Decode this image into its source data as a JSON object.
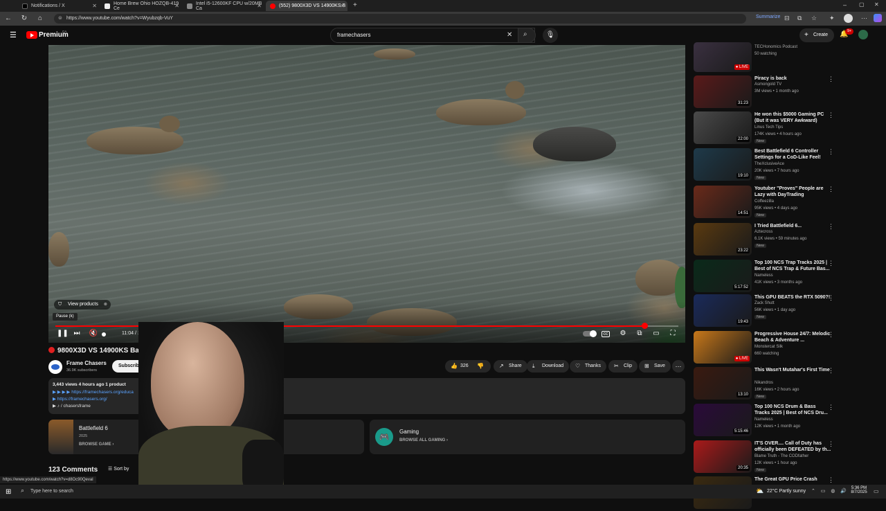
{
  "browser": {
    "tabs": [
      {
        "title": "Notifications / X",
        "active": false
      },
      {
        "title": "Home Brew Ohio HOZQB-419 Ce",
        "active": false
      },
      {
        "title": "Intel i5-12600KF CPU w/20MB Ca",
        "active": false
      },
      {
        "title": "(552) 9800X3D VS 14900KS B",
        "active": true
      }
    ],
    "url": "https://www.youtube.com/watch?v=Wyubzqb-VuY",
    "summarize_label": "Summarize",
    "status_url": "https://www.youtube.com/watch?v=d8Oc90Qeval"
  },
  "youtube": {
    "logo_text": "Premium",
    "logo_region": "CA",
    "search_value": "framechasers",
    "create_label": "Create",
    "notif_count": "9+"
  },
  "player": {
    "view_products": "View products",
    "tooltip": "Pause (k)",
    "time": "11:04 / 11:39",
    "progress": 0.945
  },
  "video": {
    "title": "9800X3D VS 14900KS Battlefield 6",
    "title_suffix": "KS",
    "channel": "Frame Chasers",
    "subscribers": "36.9K subscribers",
    "subscribe_label": "Subscribe",
    "likes": "326",
    "share": "Share",
    "download": "Download",
    "thanks": "Thanks",
    "clip": "Clip",
    "save": "Save",
    "desc_meta": "3,443 views  4 hours ago  1 product",
    "desc_links": [
      "▶ ▶ ▶ ▶  https://framechasers.org/educa",
      "▶  https://framechasers.org/",
      "▶  ♪ / chasersframe"
    ],
    "desc_tail": "SE",
    "game_title": "Battlefield 6",
    "game_year": "2025",
    "browse_game": "BROWSE GAME",
    "gaming_title": "Gaming",
    "browse_gaming": "BROWSE ALL GAMING",
    "comments": "123 Comments",
    "sort": "Sort by"
  },
  "recommendations": [
    {
      "title": "",
      "channel": "TECHonomics Podcast",
      "meta": "50 watching",
      "dur": "LIVE",
      "new": false,
      "color": "#3a3040"
    },
    {
      "title": "Piracy is back",
      "channel": "Asmongold TV",
      "meta": "3M views • 1 month ago",
      "dur": "31:23",
      "new": false,
      "color": "#5a1a1a"
    },
    {
      "title": "He won this $5000 Gaming PC (But it was VERY Awkward)",
      "channel": "Linus Tech Tips",
      "meta": "174K views • 4 hours ago",
      "dur": "22:00",
      "new": true,
      "color": "#4a4a4a"
    },
    {
      "title": "Best Battlefield 6 Controller Settings for a CoD-Like Feel!",
      "channel": "TheXclusiveAce",
      "meta": "20K views • 7 hours ago",
      "dur": "19:10",
      "new": true,
      "color": "#1e3a4a"
    },
    {
      "title": "Youtuber \"Proves\" People are Lazy with DayTrading",
      "channel": "Coffeezilla",
      "meta": "95K views • 4 days ago",
      "dur": "14:51",
      "new": true,
      "color": "#6a2a1a"
    },
    {
      "title": "I Tried Battlefield 6...",
      "channel": "Aztecross",
      "meta": "6.1K views • 59 minutes ago",
      "dur": "23:22",
      "new": true,
      "color": "#5a3a10"
    },
    {
      "title": "Top 100 NCS Trap Tracks 2025 | Best of NCS Trap & Future Bas...",
      "channel": "Nameless",
      "meta": "41K views • 3 months ago",
      "dur": "5:17:52",
      "new": false,
      "color": "#0a2a1a"
    },
    {
      "title": "This GPU BEATS the RTX 5090?!",
      "channel": "Zack Shutt",
      "meta": "56K views • 1 day ago",
      "dur": "19:43",
      "new": true,
      "color": "#1a2a5a"
    },
    {
      "title": "Progressive House 24/7: Melodic Beach & Adventure ...",
      "channel": "Monstercat Silk",
      "meta": "660 watching",
      "dur": "LIVE",
      "new": false,
      "color": "#c8781a"
    },
    {
      "title": "This Wasn't Mutahar's First Time",
      "channel": "Nikandros",
      "meta": "16K views • 2 hours ago",
      "dur": "13:10",
      "new": true,
      "color": "#3a1a10"
    },
    {
      "title": "Top 100 NCS Drum & Bass Tracks 2025 | Best of NCS Dru...",
      "channel": "Nameless",
      "meta": "12K views • 1 month ago",
      "dur": "5:15:46",
      "new": false,
      "color": "#2a0a3a"
    },
    {
      "title": "IT'S OVER.... Call of Duty has officially been DEFEATED by th...",
      "channel": "Blame Truth - The CODfather",
      "meta": "12K views • 1 hour ago",
      "dur": "20:35",
      "new": true,
      "color": "#aa1a1a"
    },
    {
      "title": "The Great GPU Price Crash",
      "channel": "",
      "meta": "",
      "dur": "",
      "new": false,
      "color": "#3a2a10"
    }
  ],
  "taskbar": {
    "search_placeholder": "Type here to search",
    "weather": "22°C  Partly sunny",
    "time": "5:36 PM",
    "date": "8/7/2025"
  }
}
